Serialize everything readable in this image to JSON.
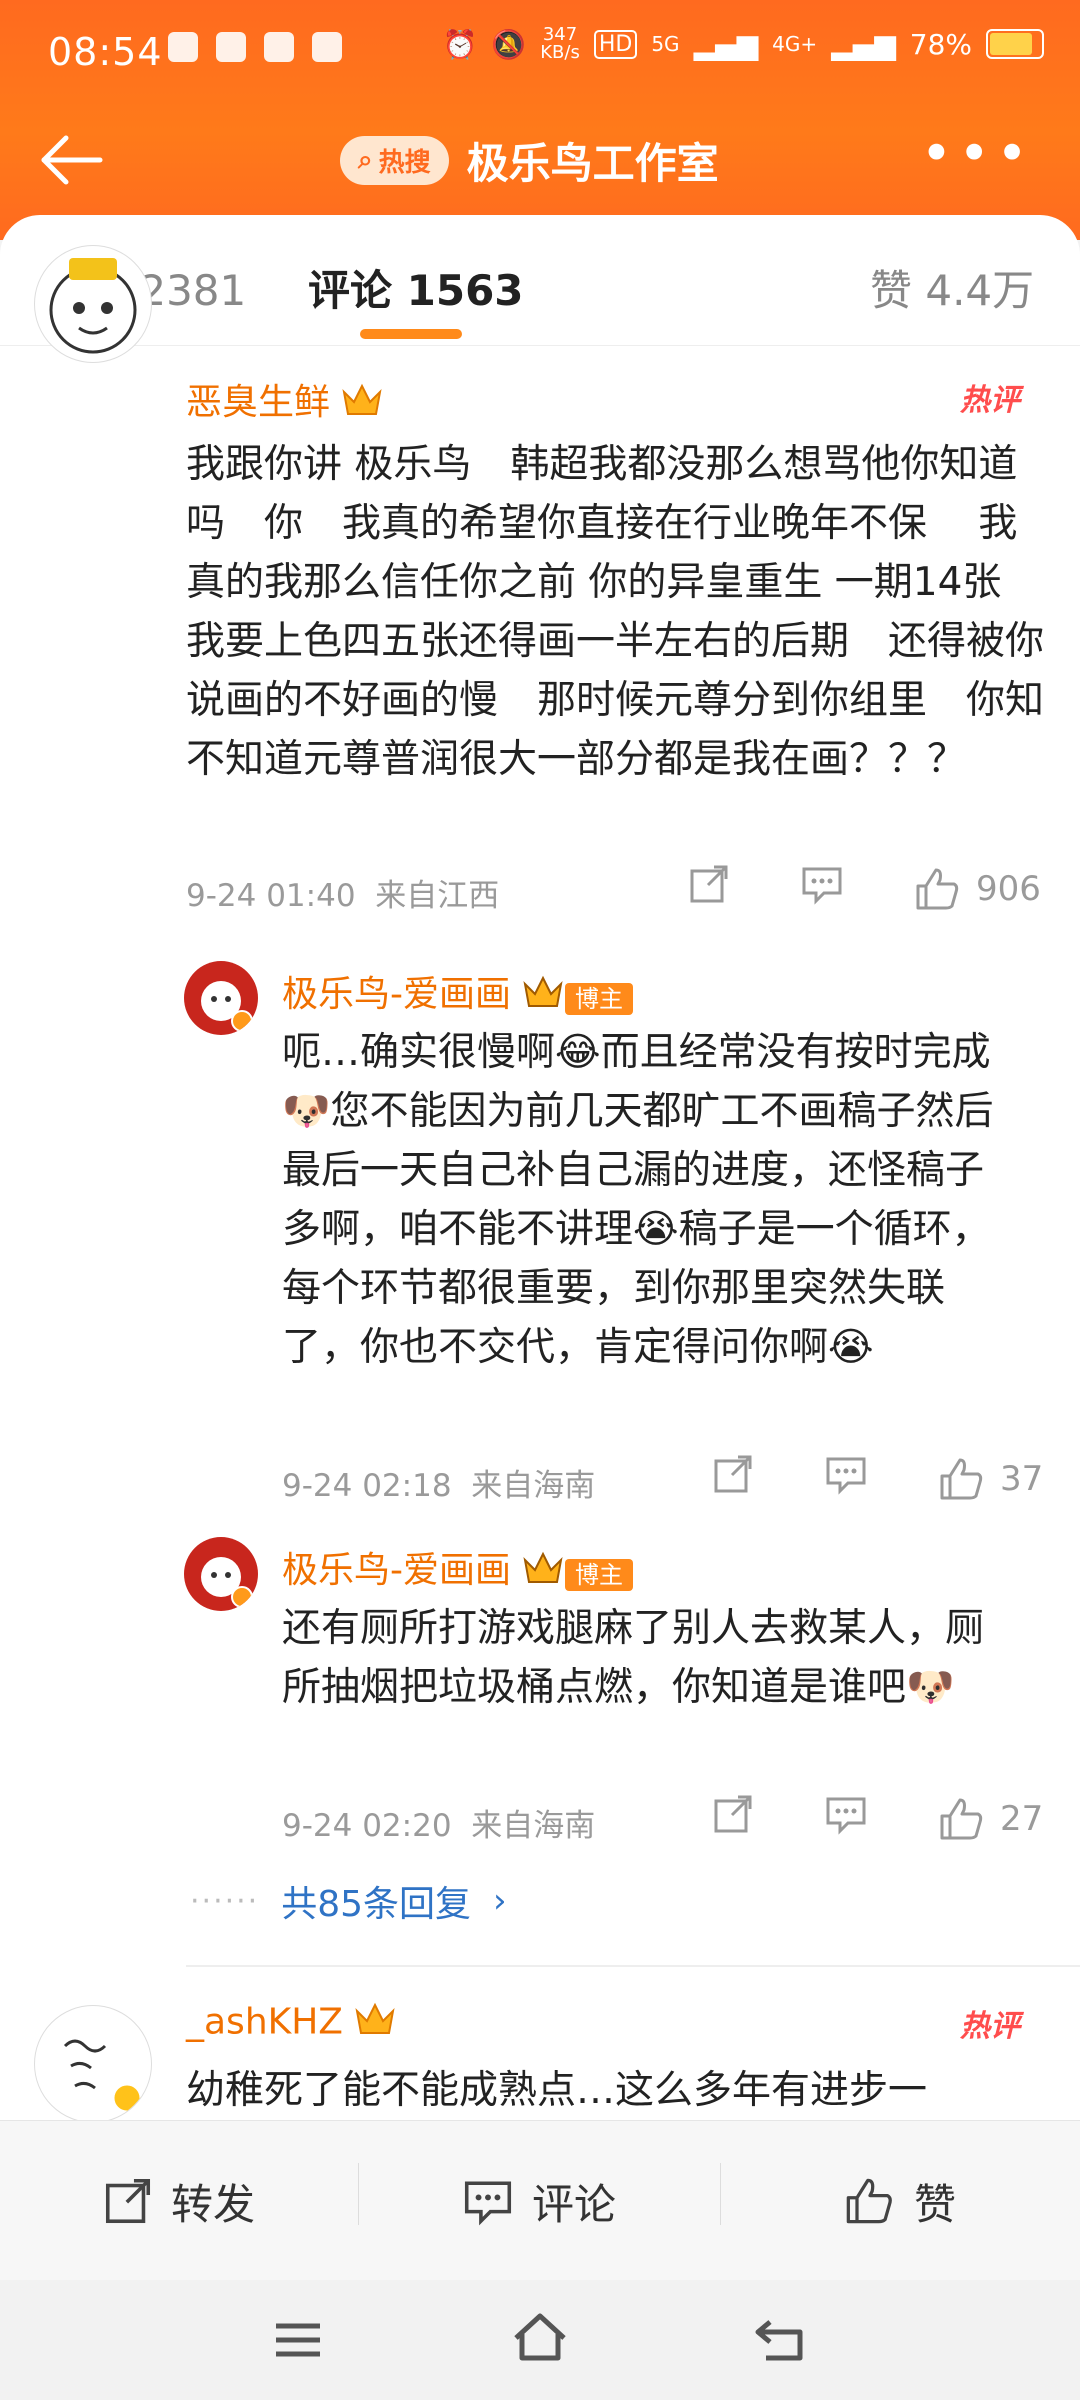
{
  "status": {
    "time": "08:54",
    "net_speed_top": "347",
    "net_speed_unit": "KB/s",
    "net_badges": [
      "HD",
      "5G",
      "4G+"
    ],
    "battery_pct": "78%"
  },
  "nav": {
    "hot_label": "热搜",
    "title": "极乐鸟工作室"
  },
  "tabs": {
    "repost": "转发 2381",
    "comments": "评论 1563",
    "likes": "赞 4.4万"
  },
  "comments": [
    {
      "user": "恶臭生鲜",
      "hot": "热评",
      "text": "我跟你讲 极乐鸟　韩超我都没那么想骂他你知道吗　你　我真的希望你直接在行业晚年不保　 我真的我那么信任你之前 你的异皇重生 一期14张 我要上色四五张还得画一半左右的后期　还得被你说画的不好画的慢　那时候元尊分到你组里　你知不知道元尊普润很大一部分都是我在画？？？",
      "date": "9-24 01:40",
      "location": "来自江西",
      "likes": "906"
    },
    {
      "user": "_ashKHZ",
      "hot": "热评",
      "text": "幼稚死了能不能成熟点…这么多年有进步一"
    }
  ],
  "replies": [
    {
      "user": "极乐鸟-爱画画",
      "badge": "博主",
      "text": "呃…确实很慢啊😂而且经常没有按时完成🐶您不能因为前几天都旷工不画稿子然后最后一天自己补自己漏的进度，还怪稿子多啊，咱不能不讲理😭稿子是一个循环，每个环节都很重要，到你那里突然失联了，你也不交代，肯定得问你啊😭",
      "date": "9-24 02:18",
      "location": "来自海南",
      "likes": "37"
    },
    {
      "user": "极乐鸟-爱画画",
      "badge": "博主",
      "text": "还有厕所打游戏腿麻了别人去救某人，厕所抽烟把垃圾桶点燃，你知道是谁吧🐶",
      "date": "9-24 02:20",
      "location": "来自海南",
      "likes": "27"
    }
  ],
  "more_replies": "共85条回复",
  "bottom": {
    "repost": "转发",
    "comment": "评论",
    "like": "赞"
  },
  "colors": {
    "header": "#ff6a1f",
    "username": "#f07000",
    "link": "#2f73c5",
    "hot": "#ff4d4d"
  }
}
